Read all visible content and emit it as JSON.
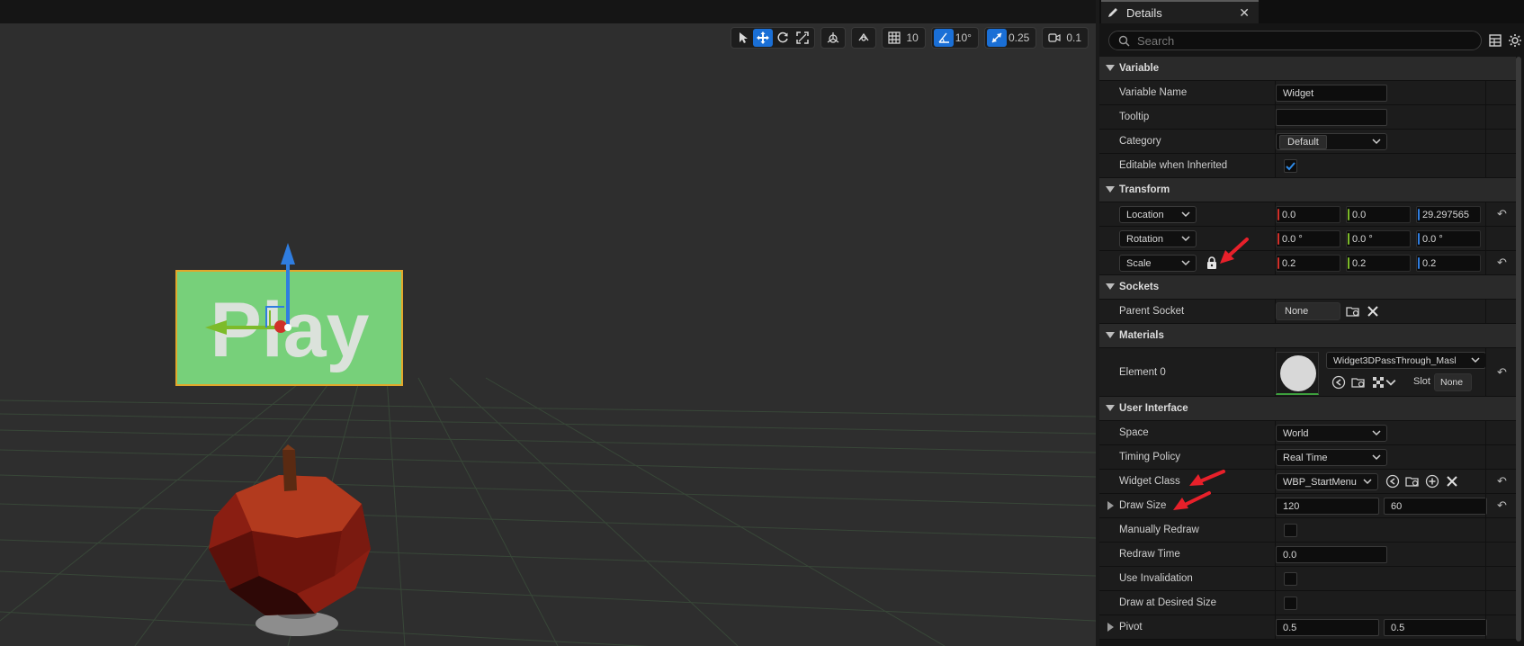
{
  "viewport": {
    "widget_text": "Play",
    "toolbar": {
      "grid_value": "10",
      "rotation_value": "10°",
      "scale_value": "0.25",
      "camera_value": "0.1"
    }
  },
  "details": {
    "tab_title": "Details",
    "tab_close": "✕",
    "search_placeholder": "Search",
    "sections": {
      "variable": "Variable",
      "transform": "Transform",
      "sockets": "Sockets",
      "materials": "Materials",
      "user_interface": "User Interface"
    },
    "variable": {
      "name_label": "Variable Name",
      "name_value": "Widget",
      "tooltip_label": "Tooltip",
      "tooltip_value": "",
      "category_label": "Category",
      "category_value": "Default",
      "editable_label": "Editable when Inherited",
      "editable_checked": true
    },
    "transform": {
      "location_label": "Location",
      "location": [
        "0.0",
        "0.0",
        "29.297565"
      ],
      "rotation_label": "Rotation",
      "rotation": [
        "0.0 °",
        "0.0 °",
        "0.0 °"
      ],
      "scale_label": "Scale",
      "scale": [
        "0.2",
        "0.2",
        "0.2"
      ]
    },
    "sockets": {
      "parent_label": "Parent Socket",
      "parent_value": "None"
    },
    "materials": {
      "element_label": "Element 0",
      "material_value": "Widget3DPassThrough_Masl",
      "slot_label": "Slot",
      "slot_value": "None"
    },
    "ui": {
      "space_label": "Space",
      "space_value": "World",
      "timing_label": "Timing Policy",
      "timing_value": "Real Time",
      "widget_class_label": "Widget Class",
      "widget_class_value": "WBP_StartMenu",
      "draw_size_label": "Draw Size",
      "draw_size": [
        "120",
        "60"
      ],
      "manual_redraw_label": "Manually Redraw",
      "redraw_time_label": "Redraw Time",
      "redraw_time_value": "0.0",
      "use_invalidation_label": "Use Invalidation",
      "draw_desired_label": "Draw at Desired Size",
      "pivot_label": "Pivot",
      "pivot": [
        "0.5",
        "0.5"
      ]
    }
  },
  "colors": {
    "accent": "#1a6fd6",
    "axis_x": "#d0302a",
    "axis_y": "#7dbb2a",
    "axis_z": "#2f7de0",
    "annotation": "#e8202a",
    "widget_green": "#77d07a"
  }
}
